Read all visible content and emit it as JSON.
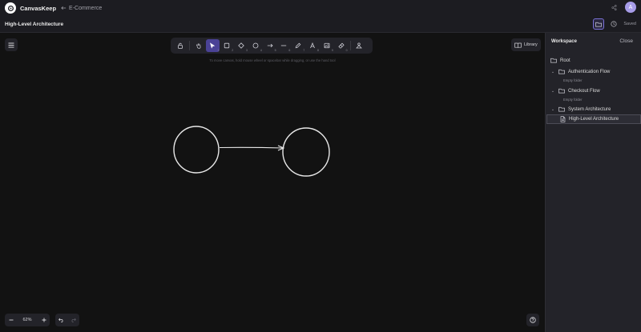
{
  "app": {
    "name": "CanvasKeep",
    "back_label": "E-Commerce",
    "avatar_initial": "A"
  },
  "doc": {
    "title": "High-Level Architecture",
    "status": "Saved"
  },
  "canvas": {
    "hint": "To move canvas, hold mouse wheel or spacebar while dragging, or use the hand tool",
    "library_label": "Library",
    "zoom": "62%",
    "tools": [
      {
        "icon": "lock-icon",
        "num": ""
      },
      {
        "icon": "hand-icon",
        "num": ""
      },
      {
        "icon": "cursor-icon",
        "num": "1",
        "active": true
      },
      {
        "icon": "rectangle-icon",
        "num": "2"
      },
      {
        "icon": "diamond-icon",
        "num": "3"
      },
      {
        "icon": "ellipse-icon",
        "num": "4"
      },
      {
        "icon": "arrow-icon",
        "num": "5"
      },
      {
        "icon": "line-icon",
        "num": "6"
      },
      {
        "icon": "pencil-icon",
        "num": "7"
      },
      {
        "icon": "text-icon",
        "num": "8"
      },
      {
        "icon": "image-icon",
        "num": "9"
      },
      {
        "icon": "eraser-icon",
        "num": "0"
      },
      {
        "icon": "shapes-icon",
        "num": ""
      }
    ]
  },
  "sidebar": {
    "title": "Workspace",
    "close_label": "Close",
    "root_label": "Root",
    "items": [
      {
        "label": "Authentication Flow",
        "sub": "Empty folder",
        "type": "folder"
      },
      {
        "label": "Checkout Flow",
        "sub": "Empty folder",
        "type": "folder"
      },
      {
        "label": "System Architecture",
        "type": "folder"
      },
      {
        "label": "High-Level Architecture",
        "type": "file",
        "selected": true
      }
    ]
  }
}
